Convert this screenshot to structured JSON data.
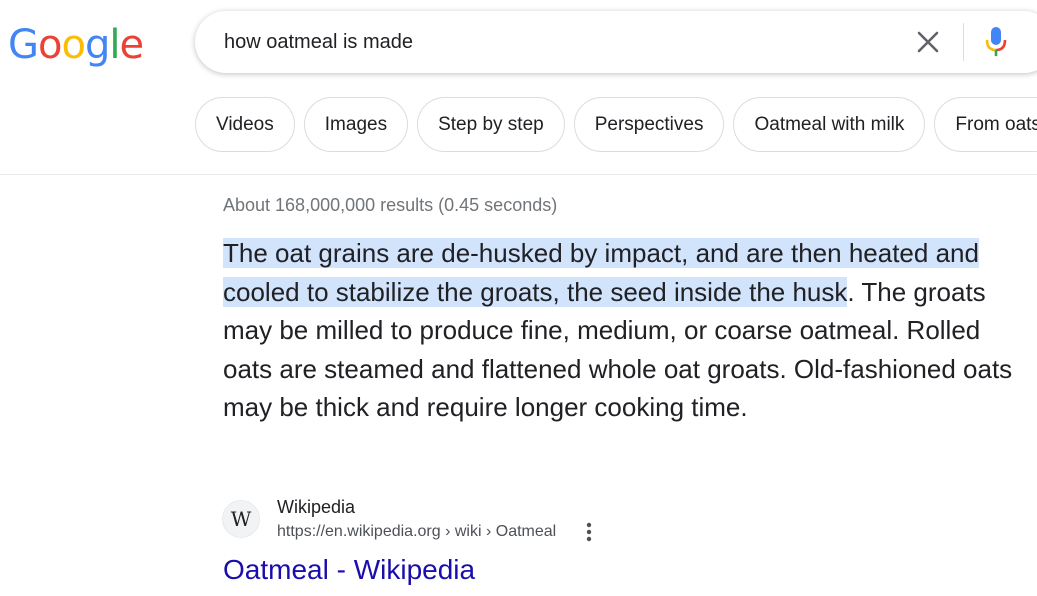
{
  "logo": {
    "letters": [
      {
        "ch": "G",
        "color": "#4285F4"
      },
      {
        "ch": "o",
        "color": "#EA4335"
      },
      {
        "ch": "o",
        "color": "#FBBC05"
      },
      {
        "ch": "g",
        "color": "#4285F4"
      },
      {
        "ch": "l",
        "color": "#34A853"
      },
      {
        "ch": "e",
        "color": "#EA4335"
      }
    ]
  },
  "search": {
    "query": "how oatmeal is made"
  },
  "icons": {
    "clear": "close-icon",
    "mic": "microphone-icon",
    "more": "more-vert-icon",
    "favicon": "wikipedia-icon"
  },
  "chips": [
    {
      "label": "Videos"
    },
    {
      "label": "Images"
    },
    {
      "label": "Step by step"
    },
    {
      "label": "Perspectives"
    },
    {
      "label": "Oatmeal with milk"
    },
    {
      "label": "From oats"
    }
  ],
  "results": {
    "stats": "About 168,000,000 results (0.45 seconds)",
    "snippet_highlight": "The oat grains are de-husked by impact, and are then heated and cooled to stabilize the groats, the seed inside the husk",
    "snippet_rest": ". The groats may be milled to produce fine, medium, or coarse oatmeal. Rolled oats are steamed and flattened whole oat groats. Old-fashioned oats may be thick and require longer cooking time.",
    "source": {
      "favicon_letter": "W",
      "site": "Wikipedia",
      "url": "https://en.wikipedia.org › wiki › Oatmeal",
      "title": "Oatmeal - Wikipedia"
    }
  },
  "colors": {
    "link": "#1a0dab",
    "highlight": "#d2e3fc",
    "mic_blue": "#4285F4",
    "mic_red": "#EA4335",
    "mic_yellow": "#FBBC05",
    "mic_green": "#34A853"
  }
}
